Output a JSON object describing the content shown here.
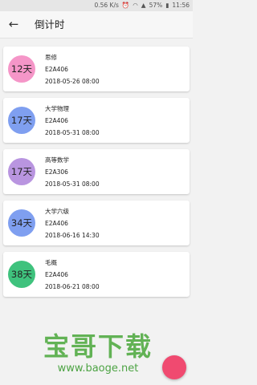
{
  "status_bar": {
    "speed": "0.56 K/s",
    "battery": "57%",
    "time": "11:56",
    "icons": [
      "alarm-icon",
      "wifi-icon",
      "signal-icon",
      "battery-icon"
    ]
  },
  "app_bar": {
    "title": "倒计时",
    "back_icon": "arrow-left-icon"
  },
  "countdowns": [
    {
      "days": "12天",
      "name": "思修",
      "room": "E2A406",
      "datetime": "2018-05-26 08:00",
      "color": "#f596c8"
    },
    {
      "days": "17天",
      "name": "大学物理",
      "room": "E2A406",
      "datetime": "2018-05-31 08:00",
      "color": "#7f9ff0"
    },
    {
      "days": "17天",
      "name": "高等数学",
      "room": "E2A306",
      "datetime": "2018-05-31 08:00",
      "color": "#b995e0"
    },
    {
      "days": "34天",
      "name": "大学六级",
      "room": "E2A406",
      "datetime": "2018-06-16 14:30",
      "color": "#7f9ff0"
    },
    {
      "days": "38天",
      "name": "毛概",
      "room": "E2A406",
      "datetime": "2018-06-21 08:00",
      "color": "#3fc27d"
    }
  ],
  "watermark": {
    "title": "宝哥下载",
    "url": "www.baoge.net"
  },
  "fab": {
    "color": "#f04a70"
  }
}
